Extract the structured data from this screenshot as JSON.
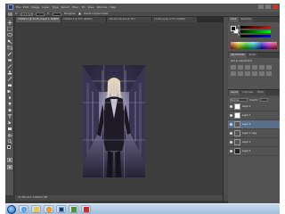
{
  "app": {
    "menu": [
      "Ps",
      "File",
      "Edit",
      "Image",
      "Layer",
      "Type",
      "Select",
      "Filter",
      "3D",
      "View",
      "Window",
      "Help"
    ],
    "workspace": "ESSENTIALS"
  },
  "options_bar": {
    "width_label": "W:",
    "height_label": "H:",
    "field_value": "1 x 1 inches",
    "checkbox_label": "Delete Cropped Pixels",
    "extra_label": "Straighten"
  },
  "document_tabs": [
    "Untitled-1 @ 33.3% (Layer 1, RGB/8)",
    "Untitled-2 @ 50% (RGB/8)",
    "CS6-tutorial.psd @ 25%",
    "model.jpg @ 12.5% (RGB/8)"
  ],
  "status_bar": "33.33%   Doc: 5.93M/17.8M",
  "panels": {
    "color_tabs": [
      "Color",
      "Swatches"
    ],
    "sliders": [
      "R",
      "G",
      "B"
    ],
    "adjustments_tabs": [
      "Adjustments",
      "Styles"
    ],
    "adjustments_title": "Add an adjustment",
    "layers_tabs": [
      "Layers",
      "Channels",
      "Paths"
    ],
    "blend_mode": "Normal",
    "opacity_label": "Opacity:",
    "layers": [
      {
        "name": "Layer 4",
        "thumb": "white"
      },
      {
        "name": "Layer 3",
        "thumb": "white"
      },
      {
        "name": "Layer 2",
        "thumb": "photo"
      },
      {
        "name": "Layer 1 copy",
        "thumb": "photo"
      },
      {
        "name": "Layer 1",
        "thumb": "photo"
      },
      {
        "name": "Layer 0",
        "thumb": "dark"
      }
    ]
  },
  "taskbar": {
    "time": "",
    "date": ""
  }
}
